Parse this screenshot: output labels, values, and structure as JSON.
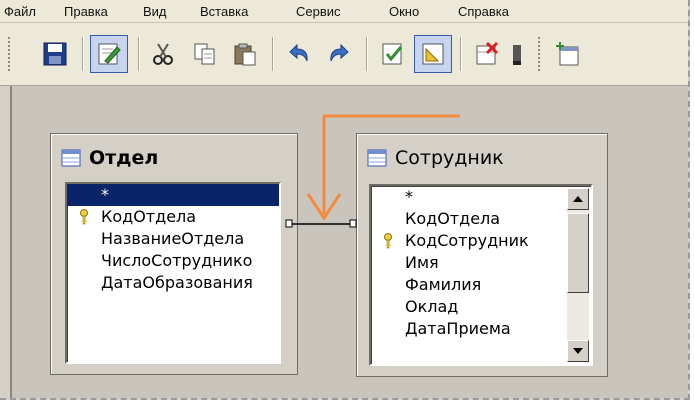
{
  "menubar": {
    "items": [
      "Файл",
      "Правка",
      "Вид",
      "Вставка",
      "Сервис",
      "Окно",
      "Справка"
    ]
  },
  "toolbar": {
    "buttons": [
      "save-icon",
      "edit-mode-icon",
      "cut-icon",
      "copy-icon",
      "paste-icon",
      "undo-icon",
      "redo-icon",
      "design-view-icon",
      "snap-icon",
      "delete-table-icon",
      "dropdown-icon",
      "add-table-icon"
    ]
  },
  "tables": {
    "otdel": {
      "title": "Отдел",
      "fields": [
        "*",
        "КодОтдела",
        "НазваниеОтдела",
        "ЧислоСотруднико",
        "ДатаОбразования"
      ]
    },
    "sotrudnik": {
      "title": "Сотрудник",
      "fields": [
        "*",
        "КодОтдела",
        "КодСотрудник",
        "Имя",
        "Фамилия",
        "Оклад",
        "ДатаПриема"
      ]
    }
  },
  "colors": {
    "selection": "#0a246a",
    "annotation_arrow": "#f48a3c",
    "background": "#d4d0c8"
  }
}
